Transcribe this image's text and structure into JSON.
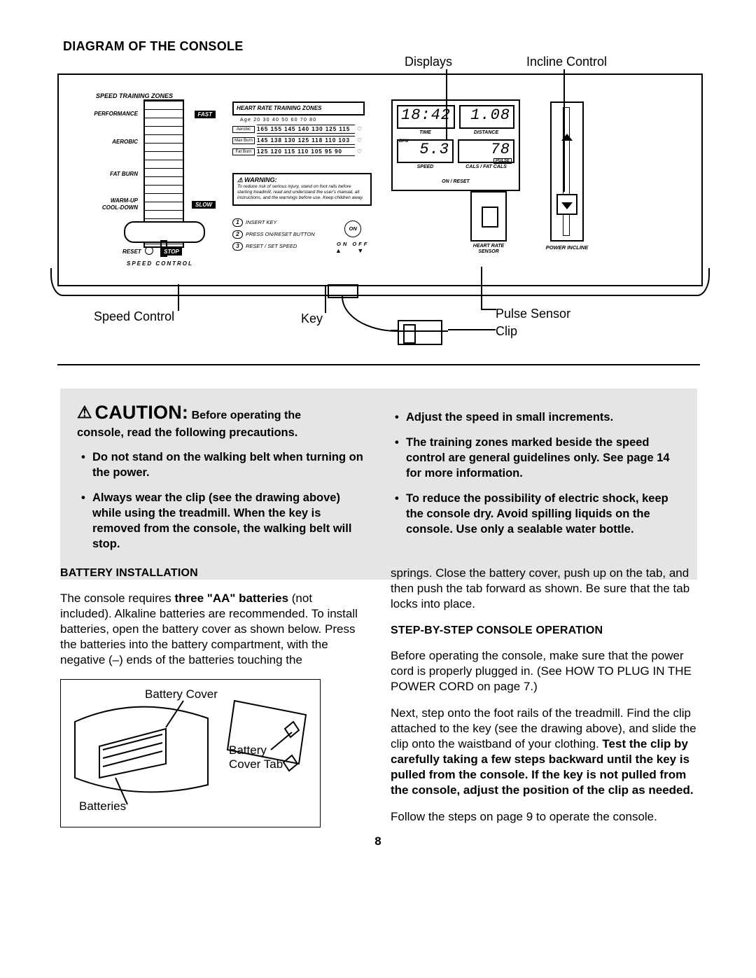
{
  "page_number": "8",
  "headings": {
    "diagram": "DIAGRAM OF THE CONSOLE",
    "battery": "BATTERY INSTALLATION",
    "operation": "STEP-BY-STEP CONSOLE OPERATION"
  },
  "callouts": {
    "displays": "Displays",
    "incline_control": "Incline Control",
    "speed_control": "Speed Control",
    "key": "Key",
    "pulse_sensor": "Pulse Sensor",
    "clip": "Clip",
    "battery_cover": "Battery Cover",
    "battery_cover_tab": "Battery",
    "battery_cover_tab2": "Cover Tab",
    "batteries": "Batteries"
  },
  "console": {
    "speed_zones": {
      "title": "SPEED TRAINING ZONES",
      "performance": "PERFORMANCE",
      "aerobic": "AEROBIC",
      "fat_burn": "FAT BURN",
      "warm_up": "WARM-UP",
      "cool_down": "COOL-DOWN",
      "fast": "FAST",
      "slow": "SLOW",
      "reset": "RESET",
      "stop": "STOP",
      "speed_control": "SPEED CONTROL"
    },
    "heart_zones": {
      "title": "HEART RATE TRAINING ZONES",
      "age_row": "Age   20   30   40   50   60   70   80",
      "aerobic_label": "Aerobic",
      "aerobic_vals": "165 155 145 140 130 125 115",
      "maxburn_label": "Max Burn",
      "maxburn_vals": "145 138 130 125 118 110 103",
      "fatburn_label": "Fat Burn",
      "fatburn_vals": "125 120 115 110 105  95  90"
    },
    "warning": {
      "title": "WARNING:",
      "body": "To reduce risk of serious injury, stand on foot rails before starting treadmill, read and understand the user's manual, all instructions, and the warnings before use. Keep children away."
    },
    "steps": {
      "s1": "INSERT KEY",
      "s2": "PRESS ON/RESET BUTTON",
      "s3": "RESET / SET SPEED"
    },
    "on": {
      "on": "ON",
      "on_off": "ON   OFF",
      "arrows": "▲   ▼"
    },
    "display": {
      "time_val": "18:42",
      "dist_val": "1.08",
      "speed_val": "5.3",
      "cals_val": "78",
      "time": "TIME",
      "distance": "DISTANCE",
      "speed": "SPEED",
      "cals": "CALS / FAT CALS",
      "bpm": "BPM",
      "pulse": "PULSE",
      "on_reset": "ON / RESET"
    },
    "hrs": {
      "l1": "HEART RATE",
      "l2": "SENSOR"
    },
    "power_incline": "POWER INCLINE"
  },
  "caution": {
    "lead_big": "CAUTION:",
    "lead_rest_1": "Before operating the",
    "lead_rest_2": "console, read the following precautions.",
    "left": [
      "Do not stand on the walking belt when turning on the power.",
      "Always wear the clip (see the drawing above) while using the treadmill. When the key is removed from the console, the walking belt will stop."
    ],
    "right": [
      "Adjust the speed in small increments.",
      "The training zones marked beside the speed control are general guidelines only. See page 14 for more information.",
      "To reduce the possibility of electric shock, keep the console dry. Avoid spilling liquids on the console. Use only a sealable water bottle."
    ]
  },
  "battery": {
    "p1a": "The console requires ",
    "p1b": "three \"AA\" batteries",
    "p1c": " (not included). Alkaline batteries are recommended. To install batteries, open the battery cover as shown below. Press the batteries into the battery compartment, with the negative (–) ends of the batteries touching the"
  },
  "right_col": {
    "p0": "springs. Close the battery cover, push up on the tab, and then push the tab forward as shown. Be sure that the tab locks into place.",
    "p1": "Before operating the console, make sure that the power cord is properly plugged in. (See HOW TO PLUG IN THE POWER CORD on page 7.)",
    "p2a": "Next, step onto the foot rails of the treadmill. Find the clip attached to the key (see the drawing above), and slide the clip onto the waistband of your clothing. ",
    "p2b": "Test the clip by carefully taking a few steps backward until the key is pulled from the console. If the key is not pulled from the console, adjust the position of the clip as needed.",
    "p3": "Follow the steps on page 9 to operate the console."
  }
}
